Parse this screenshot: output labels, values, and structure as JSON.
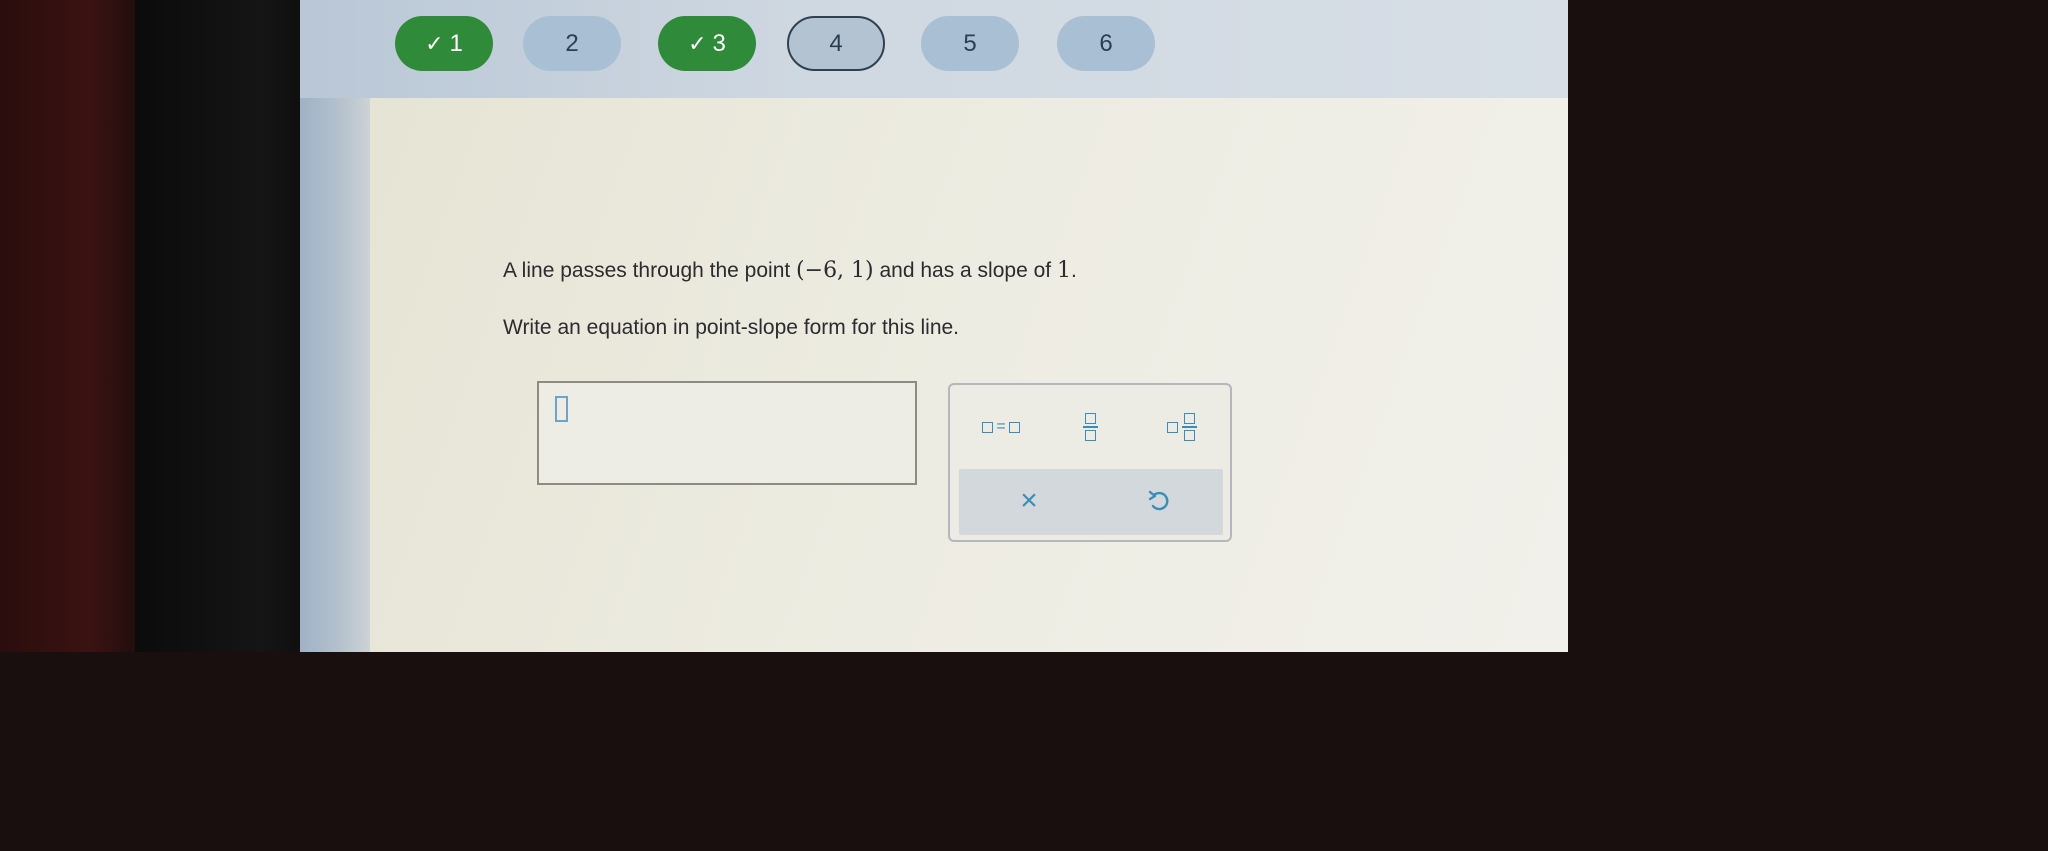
{
  "progress": {
    "pills": [
      {
        "number": "1",
        "check": "✓",
        "status": "complete"
      },
      {
        "number": "2",
        "status": "not-answered"
      },
      {
        "number": "3",
        "check": "✓",
        "status": "complete"
      },
      {
        "number": "4",
        "status": "current"
      },
      {
        "number": "5",
        "status": "not-answered"
      },
      {
        "number": "6",
        "status": "not-answered"
      }
    ]
  },
  "problem": {
    "line1_prefix": "A line passes through the point ",
    "point": "(−6, 1)",
    "line1_middle": " and has a slope of ",
    "slope": "1",
    "line1_end": ".",
    "line2": "Write an equation in point-slope form for this line."
  },
  "answer": {
    "value": ""
  },
  "toolbar": {
    "equation_icon": "equation-template-icon",
    "fraction_icon": "fraction-template-icon",
    "mixed_number_icon": "mixed-number-template-icon",
    "clear_label": "×",
    "undo_icon": "undo-icon"
  },
  "colors": {
    "complete": "#2f8a3a",
    "pill": "#a9bfd4",
    "accent": "#3a8db8"
  }
}
